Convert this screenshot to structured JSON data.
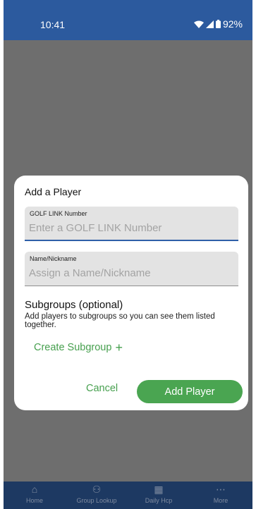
{
  "status_bar": {
    "time": "10:41",
    "battery": "92%",
    "wifi_icon": "wifi-icon",
    "signal_icon": "signal-icon",
    "battery_icon": "battery-icon"
  },
  "dialog": {
    "title": "Add a Player",
    "golf_link": {
      "label": "GOLF LINK Number",
      "placeholder": "Enter a GOLF LINK Number",
      "value": ""
    },
    "nickname": {
      "label": "Name/Nickname",
      "placeholder": "Assign a Name/Nickname",
      "value": ""
    },
    "subgroups_title": "Subgroups (optional)",
    "subgroups_desc": "Add players to subgroups so you can see them listed together.",
    "create_subgroup": "Create Subgroup",
    "cancel": "Cancel",
    "add_player": "Add Player"
  },
  "nav": {
    "items": [
      {
        "label": "Home",
        "icon": "home-icon"
      },
      {
        "label": "Group Lookup",
        "icon": "group-icon"
      },
      {
        "label": "Daily Hcp",
        "icon": "calculator-icon"
      },
      {
        "label": "More",
        "icon": "more-icon"
      }
    ]
  },
  "colors": {
    "header": "#2c5a9e",
    "accent": "#4aa551",
    "nav": "#1d3962",
    "scrim": "#6e6e6e"
  }
}
